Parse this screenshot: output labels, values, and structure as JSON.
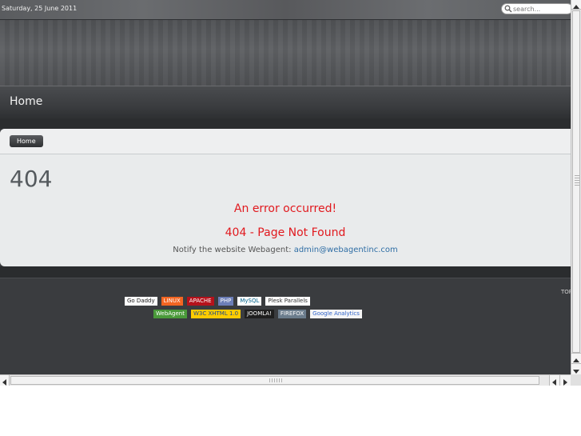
{
  "topbar": {
    "date": "Saturday, 25 June 2011",
    "search_placeholder": "search..."
  },
  "nav": {
    "home_label": "Home"
  },
  "breadcrumb": {
    "home_label": "Home"
  },
  "error": {
    "code": "404",
    "heading": "An error occurred!",
    "message": "404 - Page Not Found",
    "notify_text": "Notify the website Webagent: ",
    "notify_email": "admin@webagentinc.com"
  },
  "footer": {
    "to_top": "TOP"
  },
  "badges_row1": [
    {
      "label": "Go Daddy",
      "bg": "#fdfdfd",
      "fg": "#1a1a1a"
    },
    {
      "label": "LINUX",
      "bg": "#f26522",
      "fg": "#ffffff"
    },
    {
      "label": "APACHE",
      "bg": "#b5121b",
      "fg": "#ffffff"
    },
    {
      "label": "PHP",
      "bg": "#6c7eb7",
      "fg": "#ffffff"
    },
    {
      "label": "MySQL",
      "bg": "#ffffff",
      "fg": "#00618a"
    },
    {
      "label": "Plesk Parallels",
      "bg": "#ffffff",
      "fg": "#333333"
    }
  ],
  "badges_row2": [
    {
      "label": "WebAgent",
      "bg": "#4a9a3a",
      "fg": "#ffffff"
    },
    {
      "label": "W3C XHTML 1.0",
      "bg": "#ffcc00",
      "fg": "#1a4a8a"
    },
    {
      "label": "JOOMLA!",
      "bg": "#1f1f1f",
      "fg": "#ffffff"
    },
    {
      "label": "FIREFOX",
      "bg": "#6b7c8c",
      "fg": "#ffffff"
    },
    {
      "label": "Google Analytics",
      "bg": "#f5f5f5",
      "fg": "#3366cc"
    }
  ]
}
